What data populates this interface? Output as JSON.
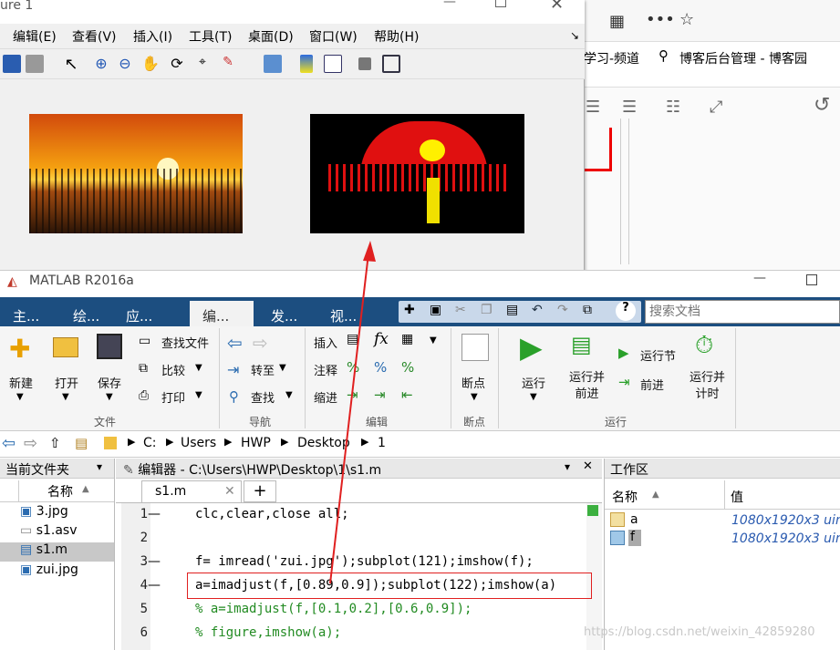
{
  "figure": {
    "title": "ure 1",
    "menus": [
      "编辑(E)",
      "查看(V)",
      "插入(I)",
      "工具(T)",
      "桌面(D)",
      "窗口(W)",
      "帮助(H)"
    ]
  },
  "browser": {
    "bookmarks": [
      "学习-频道",
      "博客后台管理 - 博客园"
    ]
  },
  "matlab": {
    "title": "MATLAB R2016a",
    "tabs": [
      "主...",
      "绘...",
      "应...",
      "编...",
      "发...",
      "视..."
    ],
    "search_placeholder": "搜索文档",
    "ribbon": {
      "new": "新建",
      "open": "打开",
      "save": "保存",
      "find_file": "查找文件",
      "compare": "比较",
      "print": "打印",
      "go_back": "",
      "goto": "转至",
      "find": "查找",
      "insert": "插入",
      "comment": "注释",
      "indent": "缩进",
      "breakpoints": "断点",
      "run": "运行",
      "run_advance": "运行并\n前进",
      "run_section": "运行节",
      "advance": "前进",
      "run_time": "运行并\n计时",
      "groups": {
        "file": "文件",
        "nav": "导航",
        "edit": "编辑",
        "bp": "断点",
        "run": "运行"
      }
    },
    "path": [
      "C:",
      "Users",
      "HWP",
      "Desktop",
      "1"
    ],
    "current_folder": {
      "title": "当前文件夹",
      "col": "名称",
      "files": [
        "3.jpg",
        "s1.asv",
        "s1.m",
        "zui.jpg"
      ]
    },
    "editor": {
      "title": "编辑器 - C:\\Users\\HWP\\Desktop\\1\\s1.m",
      "tab": "s1.m",
      "lines": [
        {
          "n": "1",
          "dash": "—",
          "t": "clc,clear,close all;"
        },
        {
          "n": "2",
          "dash": "",
          "t": ""
        },
        {
          "n": "3",
          "dash": "—",
          "t": "f= imread('zui.jpg');subplot(121);imshow(f);"
        },
        {
          "n": "4",
          "dash": "—",
          "t": "a=imadjust(f,[0.89,0.9]);subplot(122);imshow(a)"
        },
        {
          "n": "5",
          "dash": "",
          "t": "% a=imadjust(f,[0.1,0.2],[0.6,0.9]);"
        },
        {
          "n": "6",
          "dash": "",
          "t": "% figure,imshow(a);"
        }
      ]
    },
    "workspace": {
      "title": "工作区",
      "col_name": "名称",
      "col_value": "值",
      "vars": [
        {
          "name": "a",
          "value": "1080x1920x3 uin"
        },
        {
          "name": "f",
          "value": "1080x1920x3 uin"
        }
      ]
    }
  },
  "watermark": "https://blog.csdn.net/weixin_42859280"
}
